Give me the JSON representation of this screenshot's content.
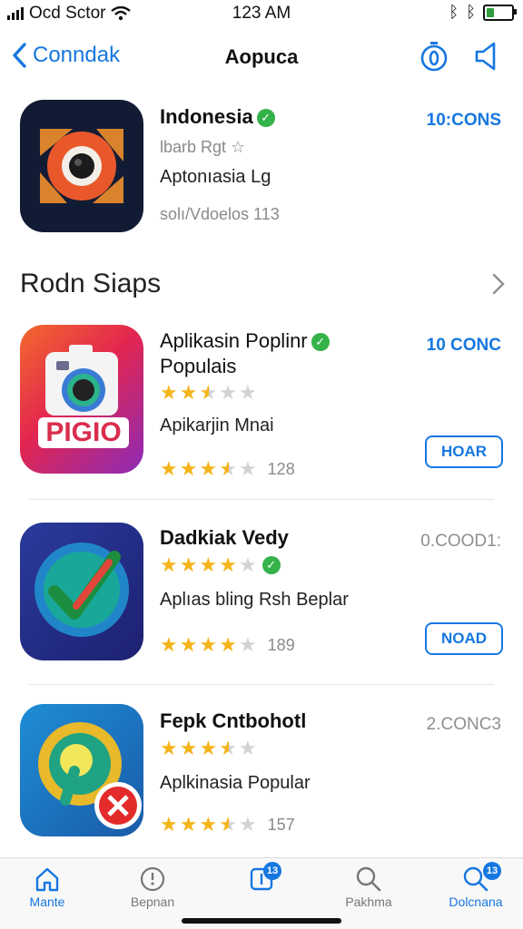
{
  "status_bar": {
    "carrier": "Ocd Sctor",
    "time": "123 AM"
  },
  "nav": {
    "back_label": "Conndak",
    "title": "Aopuca"
  },
  "featured_app": {
    "name": "Indonesia",
    "subtitle_faint": "lbarb Rgt ☆",
    "subtitle": "Aptonıasia Lg",
    "meta": "solı/Vdoelos 113",
    "price": "10:CONS"
  },
  "section": {
    "title": "Rodn Siaps"
  },
  "apps": [
    {
      "name": "Aplikasin Poplinr",
      "name_line2": "Populais",
      "icon_text": "PIGIO",
      "rating": 2.5,
      "subtitle": "Apikarjin Mnai",
      "rating2": 3.5,
      "count": "128",
      "price": "10 CONC",
      "button": "HOAR"
    },
    {
      "name": "Dadkiak Vedy",
      "rating": 4,
      "subtitle": "Aplıas bling Rsh Beplar",
      "rating2": 4,
      "count": "189",
      "price": "0.COOD1:",
      "button": "NOAD"
    },
    {
      "name": "Fepk Cntbohotl",
      "rating": 3.5,
      "subtitle": "Aplkinasia Popular",
      "rating2": 3.5,
      "count": "157",
      "price": "2.CONC3"
    }
  ],
  "tabs": [
    {
      "label": "Mante",
      "icon": "home-icon",
      "active": true
    },
    {
      "label": "Bepnan",
      "icon": "clock-icon",
      "active": false
    },
    {
      "label": "",
      "icon": "apps-icon",
      "badge": "13",
      "active": true
    },
    {
      "label": "Pakhma",
      "icon": "search-icon",
      "active": false
    },
    {
      "label": "Dolcnana",
      "icon": "search-icon",
      "badge": "13",
      "active": true
    }
  ],
  "colors": {
    "accent": "#1677e0",
    "star": "#f4b41a",
    "verified": "#35b24a"
  }
}
